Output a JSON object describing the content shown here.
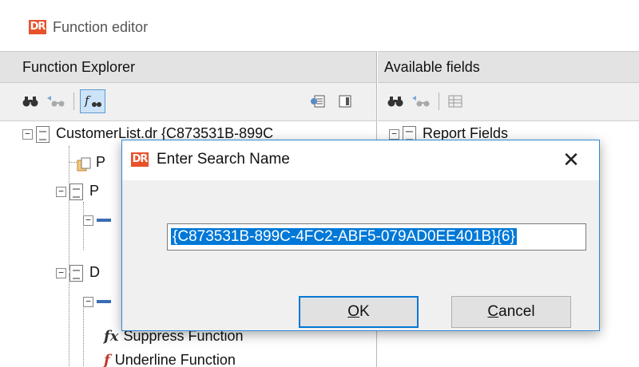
{
  "window": {
    "title": "Function editor",
    "logo_text": "DR"
  },
  "left_pane": {
    "header": "Function Explorer",
    "toolbar": [
      "binoculars-icon",
      "find-next-icon",
      "function-filter-icon",
      "list-icon",
      "panel-icon"
    ],
    "tree": [
      {
        "label": "CustomerList.dr {C873531B-899C"
      },
      {
        "label": "P"
      },
      {
        "label": "P"
      },
      {
        "label": "D"
      },
      {
        "label": "Suppress Function"
      },
      {
        "label": "Underline Function"
      }
    ]
  },
  "right_pane": {
    "header": "Available fields",
    "toolbar": [
      "binoculars-icon",
      "find-next-icon",
      "grid-icon"
    ],
    "tree": [
      {
        "label": "Report Fields"
      }
    ]
  },
  "dialog": {
    "title": "Enter Search Name",
    "logo_text": "DR",
    "close_glyph": "✕",
    "input_value": "{C873531B-899C-4FC2-ABF5-079AD0EE401B}{6}",
    "ok_label": "OK",
    "cancel_label": "Cancel",
    "ok_mnemonic": "O",
    "cancel_mnemonic": "C"
  }
}
